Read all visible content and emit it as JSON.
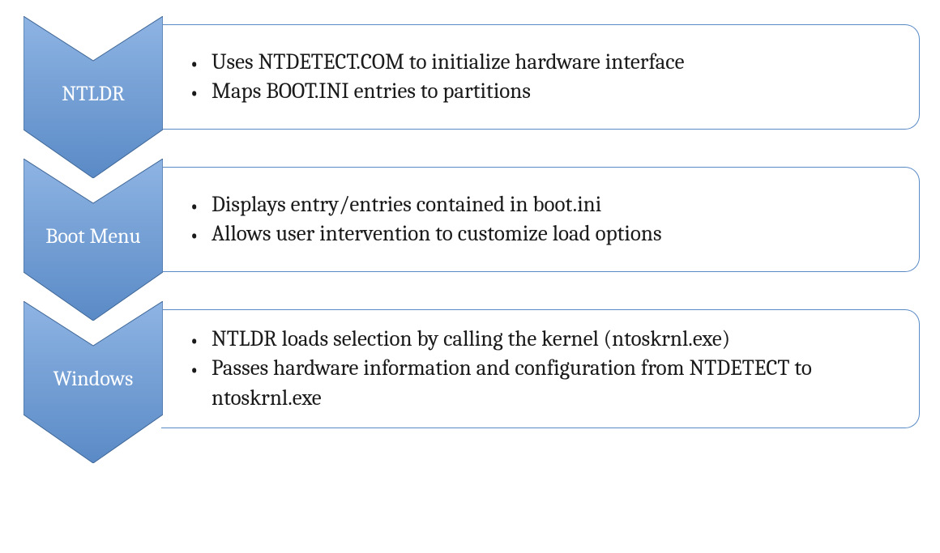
{
  "diagram": {
    "steps": [
      {
        "label": "NTLDR",
        "bullets": [
          "Uses NTDETECT.COM to initialize hardware interface",
          "Maps BOOT.INI entries to partitions"
        ]
      },
      {
        "label": "Boot Menu",
        "bullets": [
          "Displays entry/entries contained in boot.ini",
          "Allows user intervention to customize load options"
        ]
      },
      {
        "label": "Windows",
        "bullets": [
          "NTLDR loads selection by calling the kernel (ntoskrnl.exe)",
          "Passes hardware information and configuration from NTDETECT to ntoskrnl.exe"
        ]
      }
    ],
    "colors": {
      "chevron_top": "#8eb4e3",
      "chevron_bottom": "#5a8ac6",
      "chevron_stroke": "#3f6797",
      "box_border": "#5a8ac6",
      "text": "#1a1a1a"
    }
  }
}
